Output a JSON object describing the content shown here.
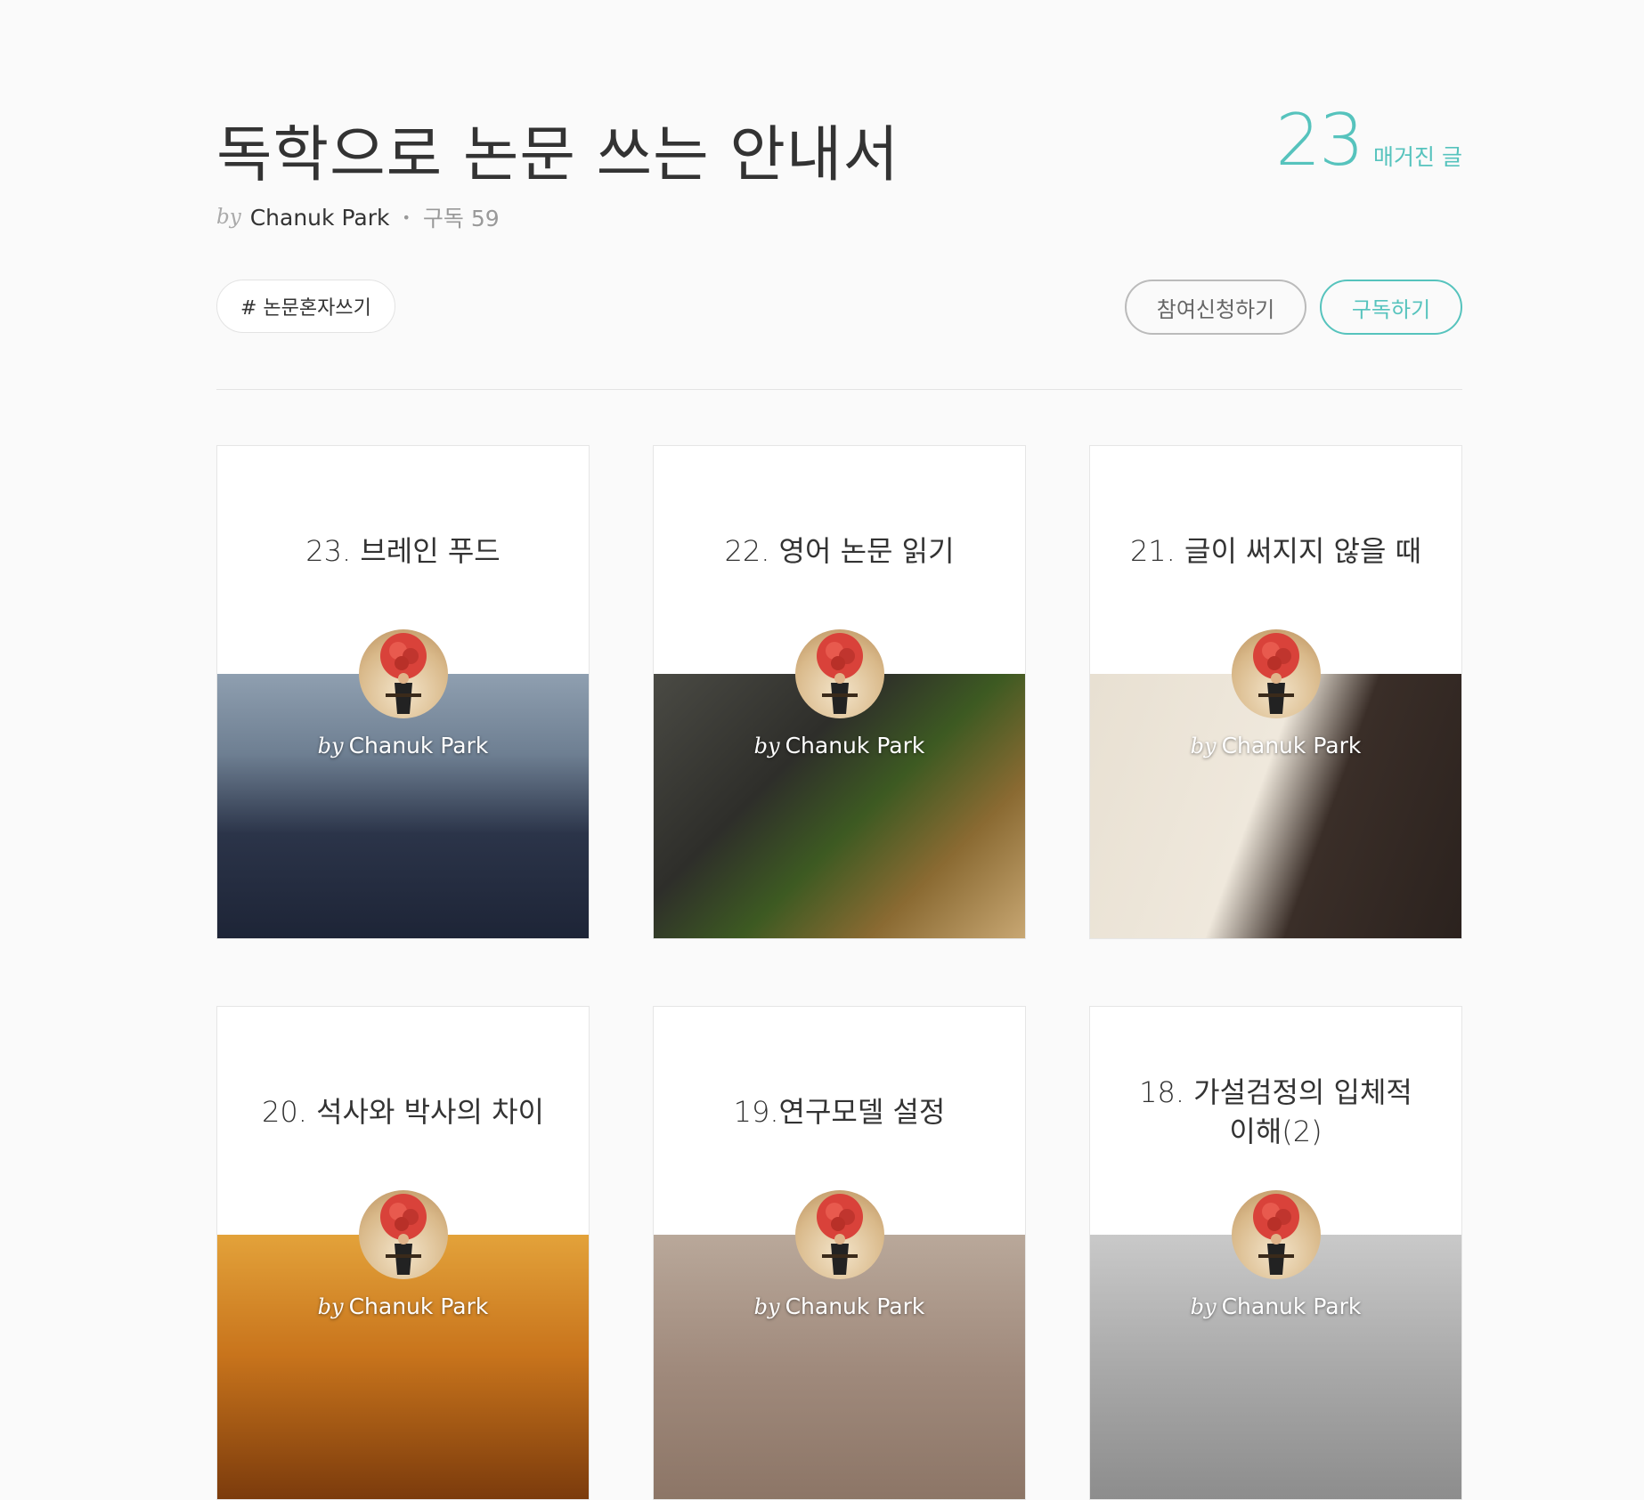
{
  "header": {
    "title": "독학으로 논문 쓰는 안내서",
    "count": "23",
    "count_label": "매거진 글",
    "by_label": "by",
    "author": "Chanuk Park",
    "subscribers": "구독 59",
    "tag": "# 논문혼자쓰기",
    "apply_button": "참여신청하기",
    "subscribe_button": "구독하기",
    "accent_color": "#56c3bd"
  },
  "cards": [
    {
      "title": "23. 브레인 푸드",
      "by_label": "by",
      "author": "Chanuk Park",
      "image_icon": "grapes-photo"
    },
    {
      "title": "22. 영어 논문 읽기",
      "by_label": "by",
      "author": "Chanuk Park",
      "image_icon": "olive-oil-photo"
    },
    {
      "title": "21. 글이 써지지 않을 때",
      "by_label": "by",
      "author": "Chanuk Park",
      "image_icon": "notebook-photo"
    },
    {
      "title": "20. 석사와 박사의 차이",
      "by_label": "by",
      "author": "Chanuk Park",
      "image_icon": "graduation-caps-photo"
    },
    {
      "title": "19.연구모델 설정",
      "by_label": "by",
      "author": "Chanuk Park",
      "image_icon": "books-photo"
    },
    {
      "title": "18. 가설검정의 입체적 이해(2)",
      "by_label": "by",
      "author": "Chanuk Park",
      "image_icon": "dice-photo"
    }
  ]
}
